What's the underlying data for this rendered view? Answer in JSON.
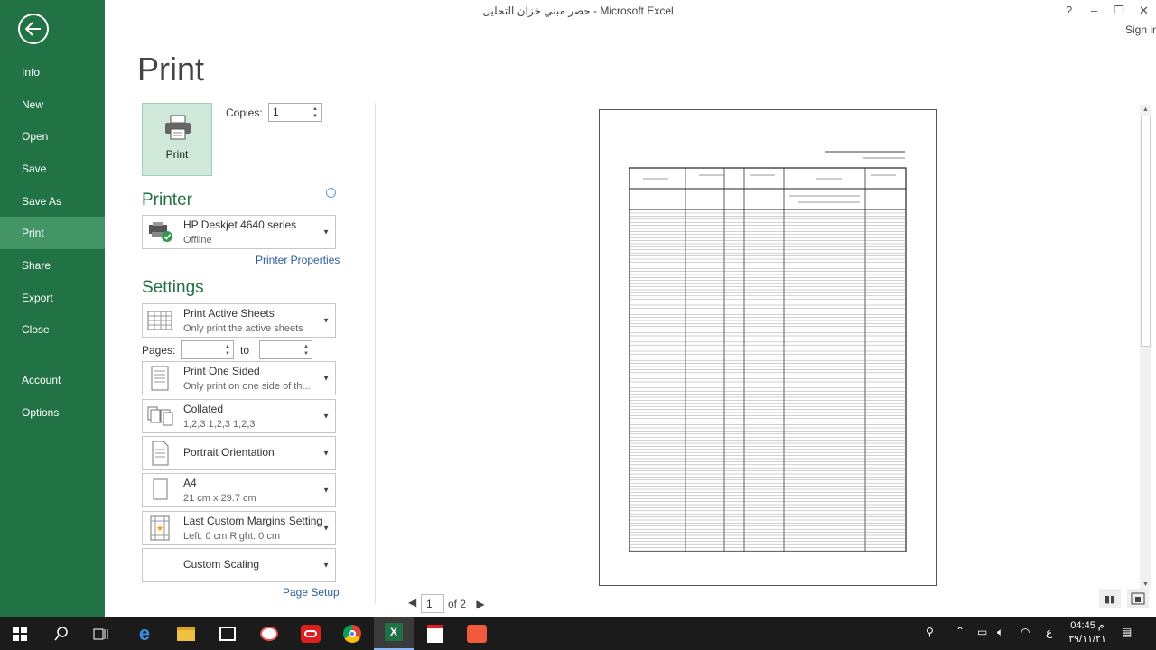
{
  "window": {
    "title": "حصر مبني خزان التحليل - Microsoft Excel",
    "help": "?",
    "minimize": "–",
    "restore": "❐",
    "close": "✕",
    "signin": "Sign in"
  },
  "nav": {
    "items": [
      {
        "label": "Info"
      },
      {
        "label": "New"
      },
      {
        "label": "Open"
      },
      {
        "label": "Save"
      },
      {
        "label": "Save As"
      },
      {
        "label": "Print"
      },
      {
        "label": "Share"
      },
      {
        "label": "Export"
      },
      {
        "label": "Close"
      },
      {
        "label": "Account"
      },
      {
        "label": "Options"
      }
    ],
    "active": "Print"
  },
  "print": {
    "page_title": "Print",
    "button_label": "Print",
    "copies_label": "Copies:",
    "copies_value": "1"
  },
  "printer": {
    "heading": "Printer",
    "name": "HP Deskjet 4640 series",
    "status": "Offline",
    "properties_link": "Printer Properties"
  },
  "settings": {
    "heading": "Settings",
    "what": {
      "title": "Print Active Sheets",
      "sub": "Only print the active sheets"
    },
    "pages_label": "Pages:",
    "to_label": "to",
    "sided": {
      "title": "Print One Sided",
      "sub": "Only print on one side of th..."
    },
    "collation": {
      "title": "Collated",
      "sub": "1,2,3    1,2,3    1,2,3"
    },
    "orientation": {
      "title": "Portrait Orientation"
    },
    "paper": {
      "title": "A4",
      "sub": "21 cm x 29.7 cm"
    },
    "margins": {
      "title": "Last Custom Margins Setting",
      "sub": "Left:  0 cm    Right:  0 cm"
    },
    "scaling": {
      "title": "Custom Scaling"
    },
    "page_setup_link": "Page Setup"
  },
  "preview": {
    "current_page": "1",
    "total_pages": "of 2"
  },
  "taskbar": {
    "time": "04:45 م",
    "date": "٣٩/١١/٢١",
    "lang": "ع"
  },
  "colors": {
    "nav_bg": "#217346",
    "nav_active": "#439467",
    "accent": "#217346",
    "link": "#2c5f9e"
  }
}
